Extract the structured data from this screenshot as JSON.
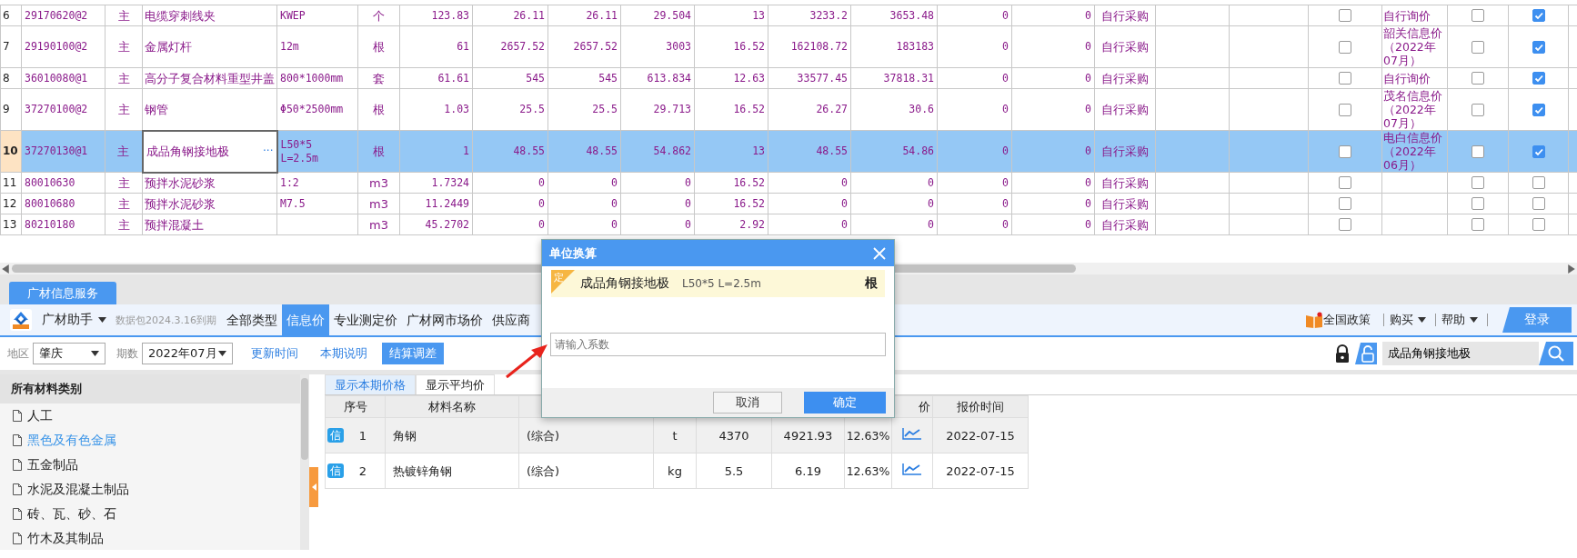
{
  "grid": {
    "edit_button": "···",
    "rows": [
      {
        "no": "6",
        "code": "29170620@2",
        "type": "主",
        "name": "电缆穿刺线夹",
        "spec": "KWEP",
        "unit": "个",
        "values": [
          "123.83",
          "26.11",
          "26.11",
          "29.504",
          "13",
          "3233.2",
          "3653.48",
          "0",
          "0"
        ],
        "source": "自行采购",
        "check_a": false,
        "price_note": "自行询价",
        "check_b": false,
        "check_c": true,
        "selected": false,
        "editing": false
      },
      {
        "no": "7",
        "code": "29190100@2",
        "type": "主",
        "name": "金属灯杆",
        "spec": "12m",
        "unit": "根",
        "values": [
          "61",
          "2657.52",
          "2657.52",
          "3003",
          "16.52",
          "162108.72",
          "183183",
          "0",
          "0"
        ],
        "source": "自行采购",
        "check_a": false,
        "price_note": "韶关信息价（2022年07月）",
        "check_b": false,
        "check_c": true,
        "selected": false,
        "editing": false
      },
      {
        "no": "8",
        "code": "36010080@1",
        "type": "主",
        "name": "高分子复合材料重型井盖",
        "spec": "800*1000mm",
        "unit": "套",
        "values": [
          "61.61",
          "545",
          "545",
          "613.834",
          "12.63",
          "33577.45",
          "37818.31",
          "0",
          "0"
        ],
        "source": "自行采购",
        "check_a": false,
        "price_note": "自行询价",
        "check_b": false,
        "check_c": true,
        "selected": false,
        "editing": false
      },
      {
        "no": "9",
        "code": "37270100@2",
        "type": "主",
        "name": "钢管",
        "spec": "Φ50*2500mm",
        "unit": "根",
        "values": [
          "1.03",
          "25.5",
          "25.5",
          "29.713",
          "16.52",
          "26.27",
          "30.6",
          "0",
          "0"
        ],
        "source": "自行采购",
        "check_a": false,
        "price_note": "茂名信息价（2022年07月）",
        "check_b": false,
        "check_c": true,
        "selected": false,
        "editing": false
      },
      {
        "no": "10",
        "code": "37270130@1",
        "type": "主",
        "name": "成品角钢接地极",
        "spec": "L50*5 L=2.5m",
        "unit": "根",
        "values": [
          "1",
          "48.55",
          "48.55",
          "54.862",
          "13",
          "48.55",
          "54.86",
          "0",
          "0"
        ],
        "source": "自行采购",
        "check_a": false,
        "price_note": "电白信息价（2022年06月）",
        "check_b": false,
        "check_c": true,
        "selected": true,
        "editing": true
      },
      {
        "no": "11",
        "code": "80010630",
        "type": "主",
        "name": "预拌水泥砂浆",
        "spec": "1:2",
        "unit": "m3",
        "values": [
          "1.7324",
          "0",
          "0",
          "0",
          "16.52",
          "0",
          "0",
          "0",
          "0"
        ],
        "source": "自行采购",
        "check_a": false,
        "check_b": false,
        "check_c": false,
        "selected": false,
        "editing": false
      },
      {
        "no": "12",
        "code": "80010680",
        "type": "主",
        "name": "预拌水泥砂浆",
        "spec": "M7.5",
        "unit": "m3",
        "values": [
          "11.2449",
          "0",
          "0",
          "0",
          "16.52",
          "0",
          "0",
          "0",
          "0"
        ],
        "source": "自行采购",
        "check_a": false,
        "check_b": false,
        "check_c": false,
        "selected": false,
        "editing": false
      },
      {
        "no": "13",
        "code": "80210180",
        "type": "主",
        "name": "预拌混凝土",
        "unit": "m3",
        "values": [
          "45.2702",
          "0",
          "0",
          "0",
          "2.92",
          "0",
          "0",
          "0",
          "0"
        ],
        "source": "自行采购",
        "check_a": false,
        "check_b": false,
        "check_c": false,
        "selected": false,
        "editing": false
      }
    ]
  },
  "service_tabs": [
    {
      "label": "广材信息服务",
      "selected": true
    }
  ],
  "toolbar": {
    "app_name": "广材助手",
    "package_note": "数据包2024.3.16到期",
    "categories": [
      {
        "label": "全部类型",
        "selected": false
      },
      {
        "label": "信息价",
        "selected": true
      },
      {
        "label": "专业测定价",
        "selected": false
      },
      {
        "label": "广材网市场价",
        "selected": false
      },
      {
        "label": "供应商",
        "selected": false
      }
    ],
    "policy_link": "全国政策",
    "menus": [
      "购买",
      "帮助"
    ],
    "login": "登录"
  },
  "filters": {
    "region_label": "地区",
    "region": "肇庆",
    "period_label": "期数",
    "period": "2022年07月",
    "buttons": [
      {
        "label": "更新时间",
        "kind": "link"
      },
      {
        "label": "本期说明",
        "kind": "link"
      },
      {
        "label": "结算调差",
        "kind": "primary"
      }
    ],
    "search": {
      "value": "成品角钢接地极"
    }
  },
  "category_panel": {
    "title": "所有材料类别",
    "items": [
      {
        "label": "人工",
        "selected": false
      },
      {
        "label": "黑色及有色金属",
        "selected": true
      },
      {
        "label": "五金制品",
        "selected": false
      },
      {
        "label": "水泥及混凝土制品",
        "selected": false
      },
      {
        "label": "砖、瓦、砂、石",
        "selected": false
      },
      {
        "label": "竹木及其制品",
        "selected": false
      }
    ]
  },
  "price_tabs": [
    {
      "label": "显示本期价格",
      "selected": true
    },
    {
      "label": "显示平均价",
      "selected": false
    }
  ],
  "price_table": {
    "header": {
      "number": "序号",
      "name": "材料名称",
      "column_8": "价",
      "quote_time": "报价时间"
    },
    "rows": [
      {
        "badge": "信",
        "no": "1",
        "name": "角钢",
        "spec": "(综合)",
        "unit": "t",
        "price": "4370",
        "tax_price": "4921.93",
        "rate": "12.63%",
        "date": "2022-07-15"
      },
      {
        "badge": "信",
        "no": "2",
        "name": "热镀锌角钢",
        "spec": "(综合)",
        "unit": "kg",
        "price": "5.5",
        "tax_price": "6.19",
        "rate": "12.63%",
        "date": "2022-07-15"
      }
    ]
  },
  "dialog": {
    "title": "单位换算",
    "badge": "定",
    "material": "成品角钢接地极",
    "spec": "L50*5 L=2.5m",
    "unit": "根",
    "input_placeholder": "请输入系数",
    "buttons": [
      {
        "label": "取消",
        "kind": "secondary"
      },
      {
        "label": "确定",
        "kind": "primary"
      }
    ]
  }
}
